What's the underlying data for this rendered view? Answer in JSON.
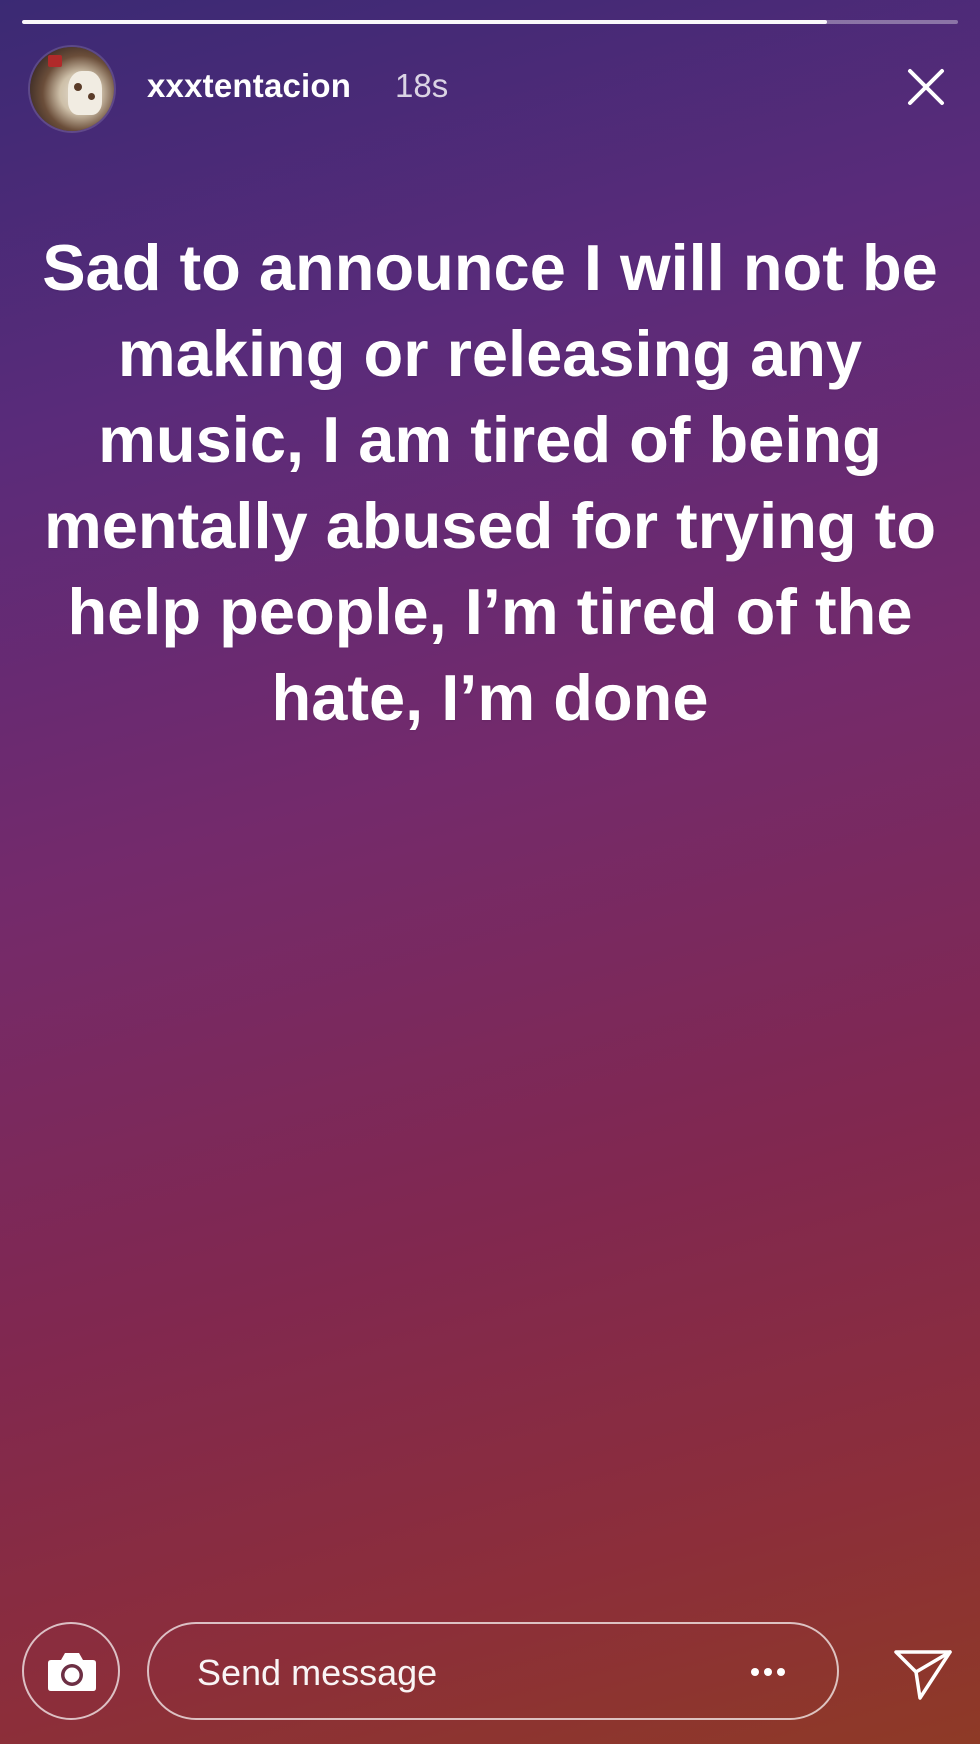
{
  "story": {
    "progress": 0.86,
    "background_gradient": [
      "#3b2a74",
      "#742a6b",
      "#81284f",
      "#8e3a26"
    ]
  },
  "header": {
    "username": "xxxtentacion",
    "timestamp": "18s",
    "close_icon": "close-icon"
  },
  "content": {
    "text": "Sad to announce I will not be making or releasing any music, I am tired of being mentally abused for trying to help people, I’m tired of the hate, I’m done"
  },
  "footer": {
    "camera_icon": "camera-icon",
    "message_placeholder": "Send message",
    "more_icon": "more-dots-icon",
    "send_icon": "paper-plane-icon"
  }
}
